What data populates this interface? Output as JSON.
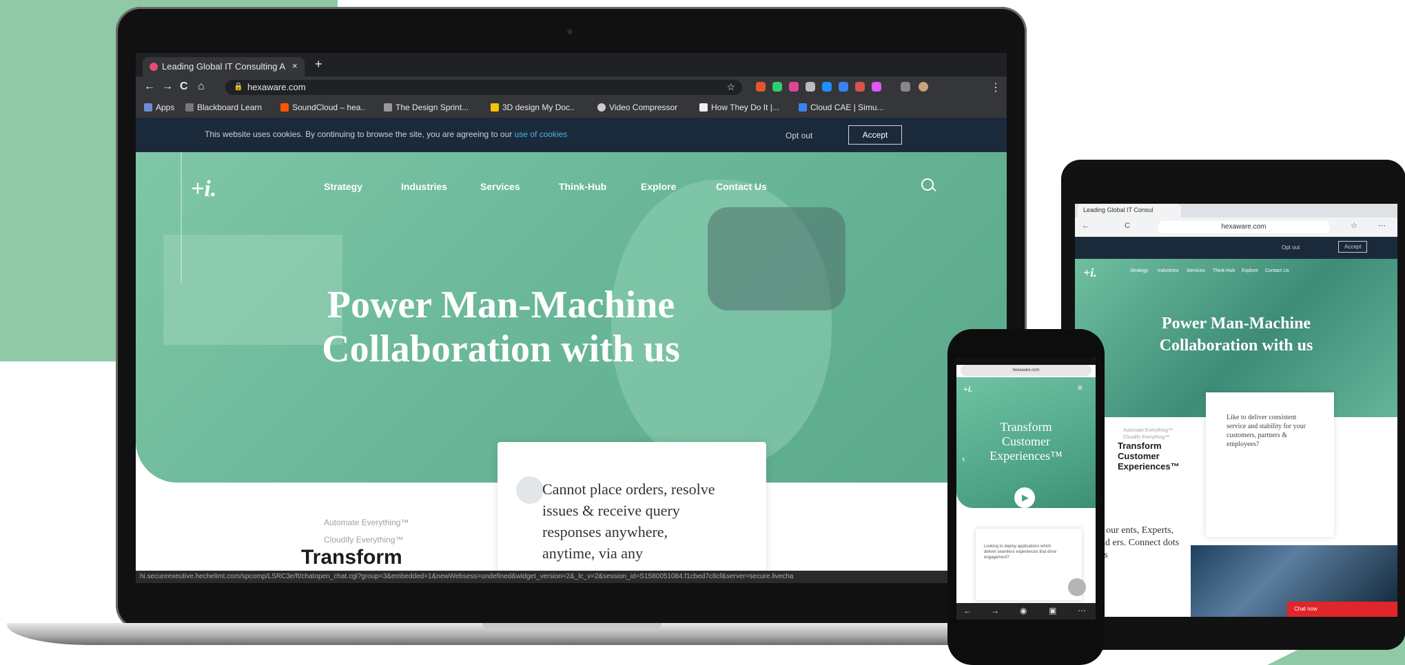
{
  "laptop": {
    "tab_title": "Leading Global IT Consulting A",
    "tab_close": "×",
    "new_tab": "+",
    "nav": {
      "back": "←",
      "forward": "→",
      "reload": "C",
      "home": "⌂"
    },
    "url": "hexaware.com",
    "bookmarks": [
      "Apps",
      "Blackboard Learn",
      "SoundCloud – hea..",
      "The Design Sprint...",
      "3D design My Doc..",
      "Video Compressor",
      "How They Do It |...",
      "Cloud CAE | Simu..."
    ],
    "cookie": {
      "text": "This website uses cookies. By continuing to browse the site, you are agreeing to our",
      "link": "use of cookies",
      "opt_out": "Opt out",
      "accept": "Accept"
    },
    "menu": [
      "Strategy",
      "Industries",
      "Services",
      "Think-Hub",
      "Explore",
      "Contact Us"
    ],
    "logo": "+i.",
    "hero_title_line1": "Power Man-Machine",
    "hero_title_line2": "Collaboration with us",
    "tag1": "Automate Everything™",
    "tag2": "Cloudify Everything™",
    "transform": "Transform",
    "card_text": "Cannot place orders, resolve issues & receive query responses anywhere, anytime, via any",
    "status_url": "hi.secureexeutive.hechelimt.com/spcomp/LSRC3e/ft/chatopen_chat.cgi?group=3&embedded=1&newWebsess=undefined&widget_version=2&_lc_v=2&session_id=S1580051084.f1cbed7c8cf&server=secure.livecha"
  },
  "tablet": {
    "tab_title": "Leading Global IT Consul",
    "url": "hexaware.com",
    "opt_out": "Opt out",
    "accept": "Accept",
    "logo": "+i.",
    "menu": [
      "Strategy",
      "Industries",
      "Services",
      "Think-Hub",
      "Explore",
      "Contact Us"
    ],
    "title_line1": "Power Man-Machine",
    "title_line2": "Collaboration with us",
    "tag1": "Automate Everything™",
    "tag2": "Cloudify Everything™",
    "transform_l1": "Transform",
    "transform_l2": "Customer",
    "transform_l3": "Experiences™",
    "card_text": "Like to deliver consistent service and stability for your customers, partners & employees?",
    "hear": "ar from our ents, Experts, tners and ers. Connect dots for iness",
    "chat": "Chat now"
  },
  "phone": {
    "url": "hexaware.com",
    "logo": "+i.",
    "title_line1": "Transform",
    "title_line2": "Customer",
    "title_line3": "Experiences™",
    "card_text": "Looking to deploy applications which deliver seamless experiences that drive engagement?"
  },
  "colors": {
    "brand_green": "#7fc7a6",
    "accent_bg": "#8fc9a6",
    "cookie_bg": "#1b2a3a",
    "link": "#48b6e6"
  }
}
